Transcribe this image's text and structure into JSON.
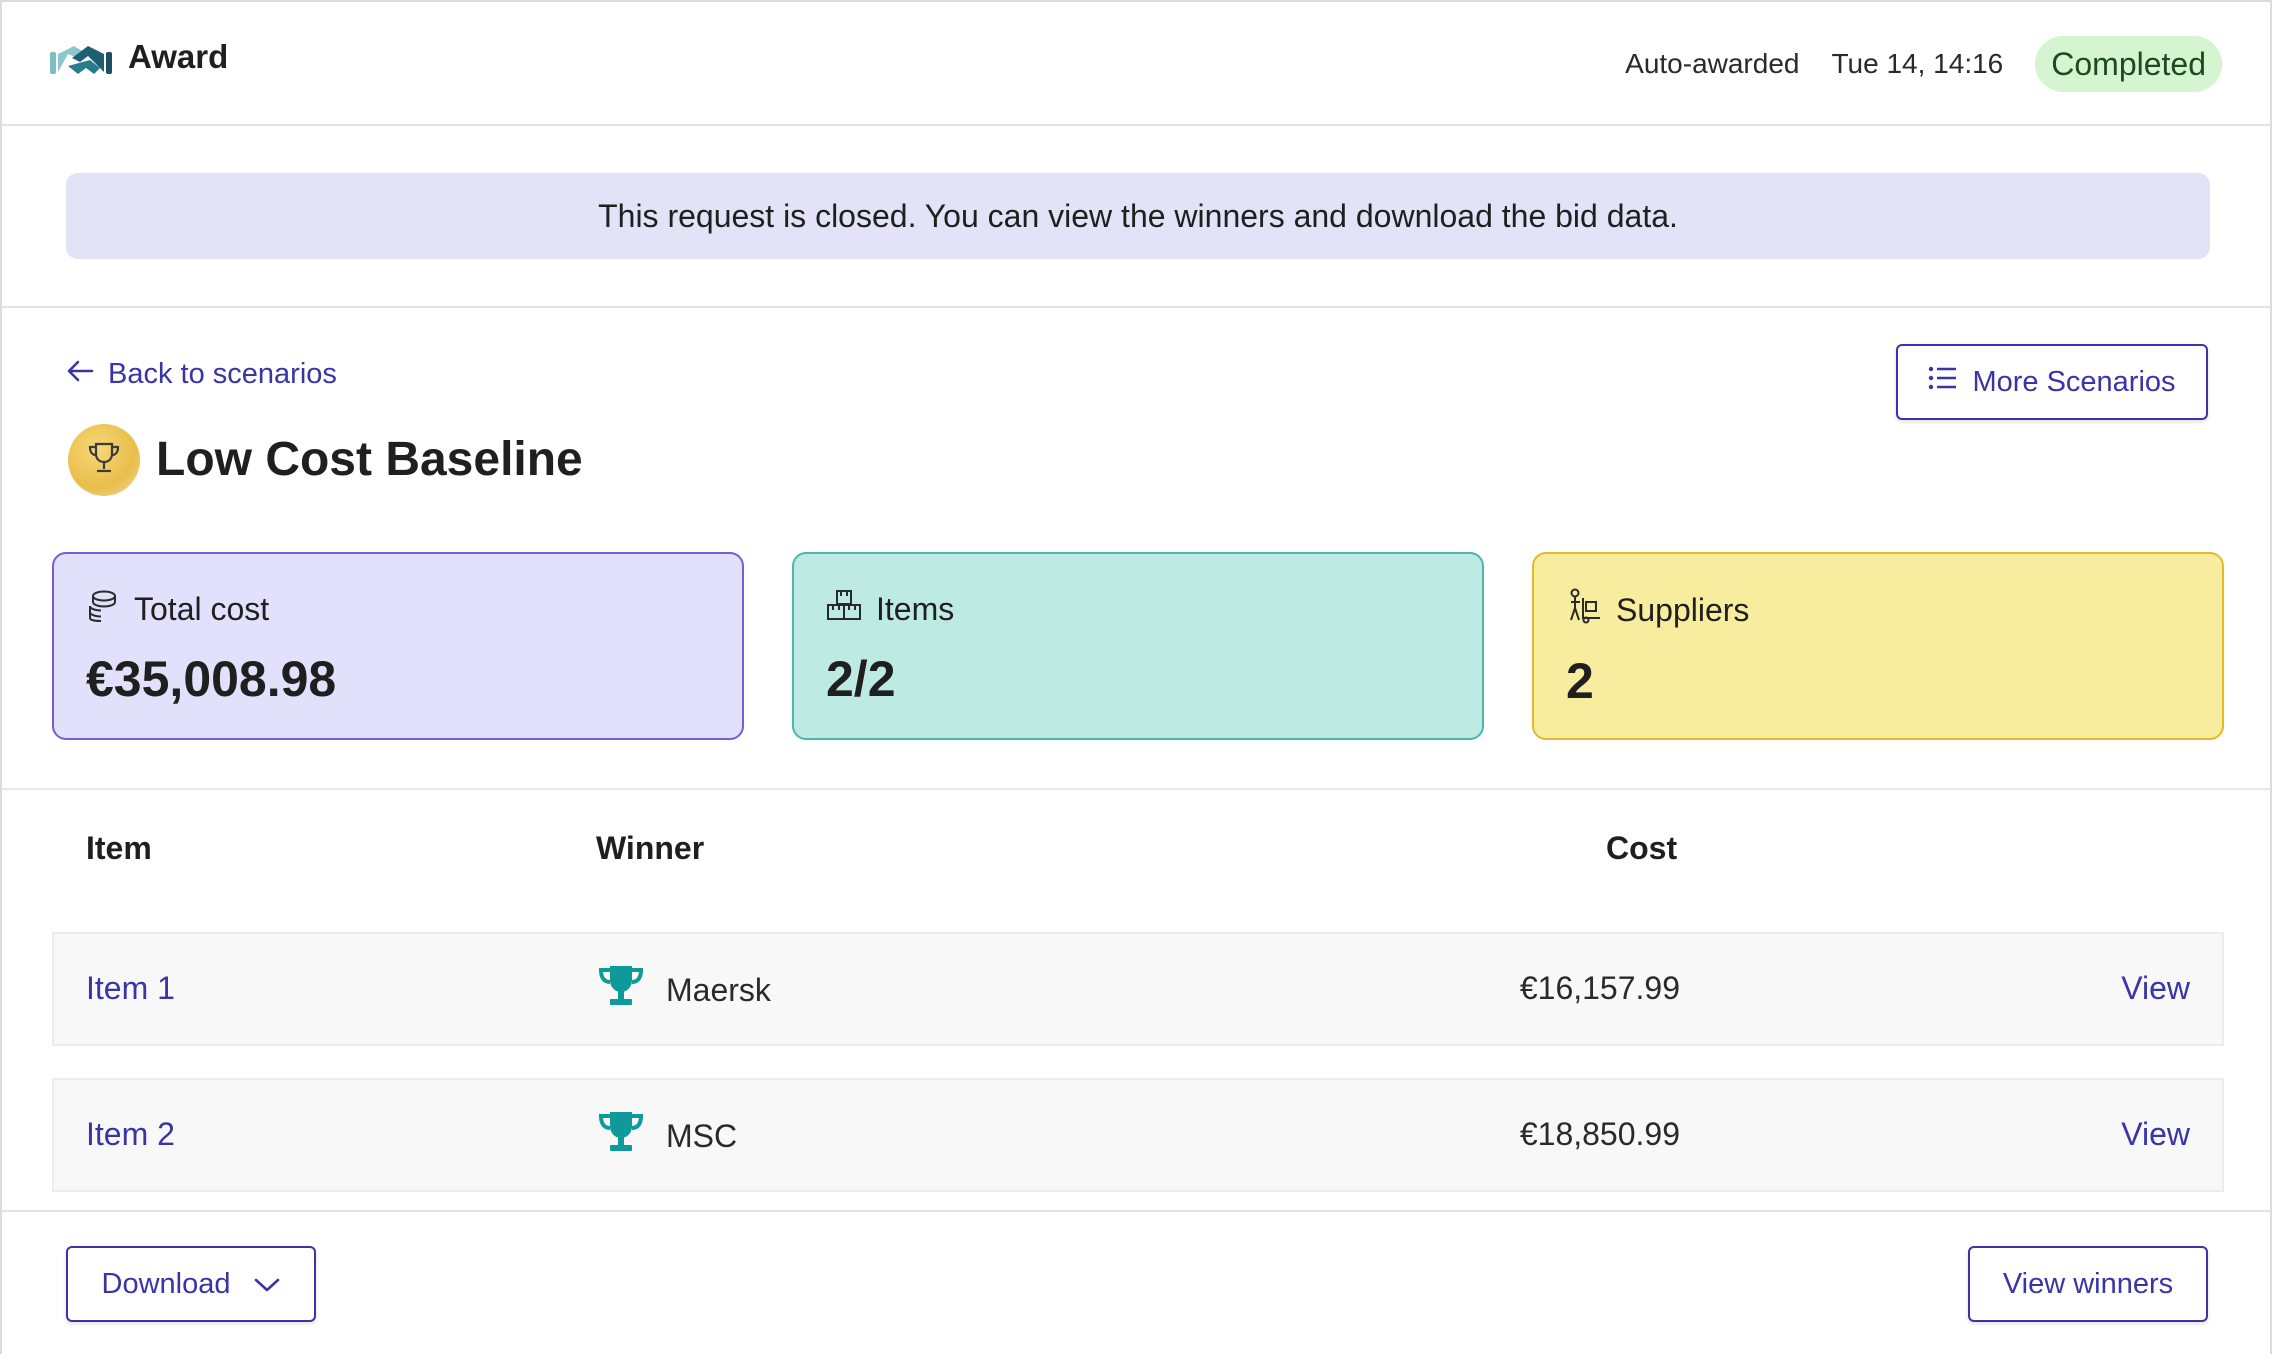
{
  "header": {
    "app_title": "Award",
    "award_mode": "Auto-awarded",
    "timestamp": "Tue 14, 14:16",
    "status": "Completed"
  },
  "banner": {
    "message": "This request is closed. You can view the winners and download the bid data."
  },
  "scenario": {
    "back_label": "Back to scenarios",
    "more_label": "More Scenarios",
    "title": "Low Cost Baseline"
  },
  "stats": {
    "total_cost": {
      "label": "Total cost",
      "value": "€35,008.98"
    },
    "items": {
      "label": "Items",
      "value": "2/2"
    },
    "suppliers": {
      "label": "Suppliers",
      "value": "2"
    }
  },
  "table": {
    "headers": {
      "item": "Item",
      "winner": "Winner",
      "cost": "Cost"
    },
    "rows": [
      {
        "item": "Item 1",
        "winner": "Maersk",
        "cost": "€16,157.99",
        "action": "View"
      },
      {
        "item": "Item 2",
        "winner": "MSC",
        "cost": "€18,850.99",
        "action": "View"
      }
    ]
  },
  "footer": {
    "download_label": "Download",
    "view_winners_label": "View winners"
  },
  "colors": {
    "accent": "#3a34a8",
    "status_bg": "#d4f5d0",
    "banner_bg": "#e3e2f6",
    "trophy": "#0e9a9a"
  }
}
